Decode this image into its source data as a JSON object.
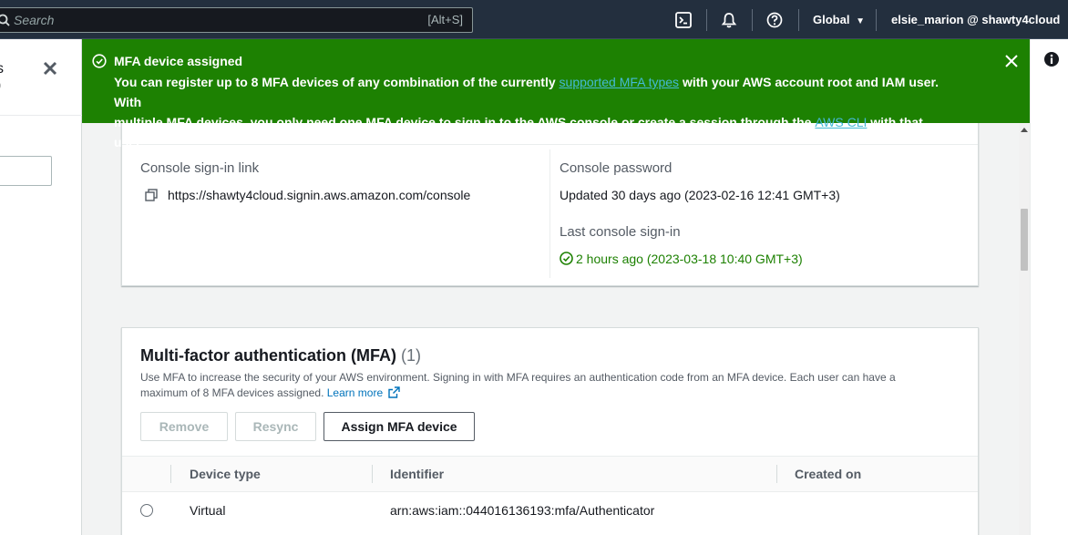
{
  "topbar": {
    "search_placeholder": "Search",
    "search_shortcut": "[Alt+S]",
    "cloudshell_icon": "terminal-icon",
    "notifications_icon": "bell-icon",
    "help_icon": "question-circle-icon",
    "region": "Global",
    "account": "elsie_marion @ shawty4cloud"
  },
  "left_panel": {
    "fragment_line1": "s",
    "fragment_line2": ")"
  },
  "flash": {
    "title": "MFA device assigned",
    "line1_pre": "You can register up to 8 MFA devices of any combination of the currently ",
    "line1_link": "supported MFA types",
    "line1_post": " with your AWS account root and IAM user. With",
    "line2_pre": "multiple MFA devices, you only need one MFA device to sign in to the AWS console or create a session through the ",
    "line2_link": "AWS CLI",
    "line2_post": " with that user.",
    "color": "#1d8102"
  },
  "console_access": {
    "signin_link_label": "Console sign-in link",
    "signin_link_value": "https://shawty4cloud.signin.aws.amazon.com/console",
    "password_label": "Console password",
    "password_value": "Updated 30 days ago (2023-02-16 12:41 GMT+3)",
    "last_signin_label": "Last console sign-in",
    "last_signin_value": "2 hours ago (2023-03-18 10:40 GMT+3)"
  },
  "mfa": {
    "title": "Multi-factor authentication (MFA)",
    "count": "(1)",
    "description_line1": "Use MFA to increase the security of your AWS environment. Signing in with MFA requires an authentication code from an MFA device. Each user can have a",
    "description_line2": "maximum of 8 MFA devices assigned. ",
    "learn_more": "Learn more",
    "buttons": {
      "remove": "Remove",
      "resync": "Resync",
      "assign": "Assign MFA device"
    },
    "columns": [
      "Device type",
      "Identifier",
      "Created on"
    ],
    "rows": [
      {
        "device_type": "Virtual",
        "identifier": "arn:aws:iam::044016136193:mfa/Authenticator",
        "created_on": ""
      }
    ]
  }
}
